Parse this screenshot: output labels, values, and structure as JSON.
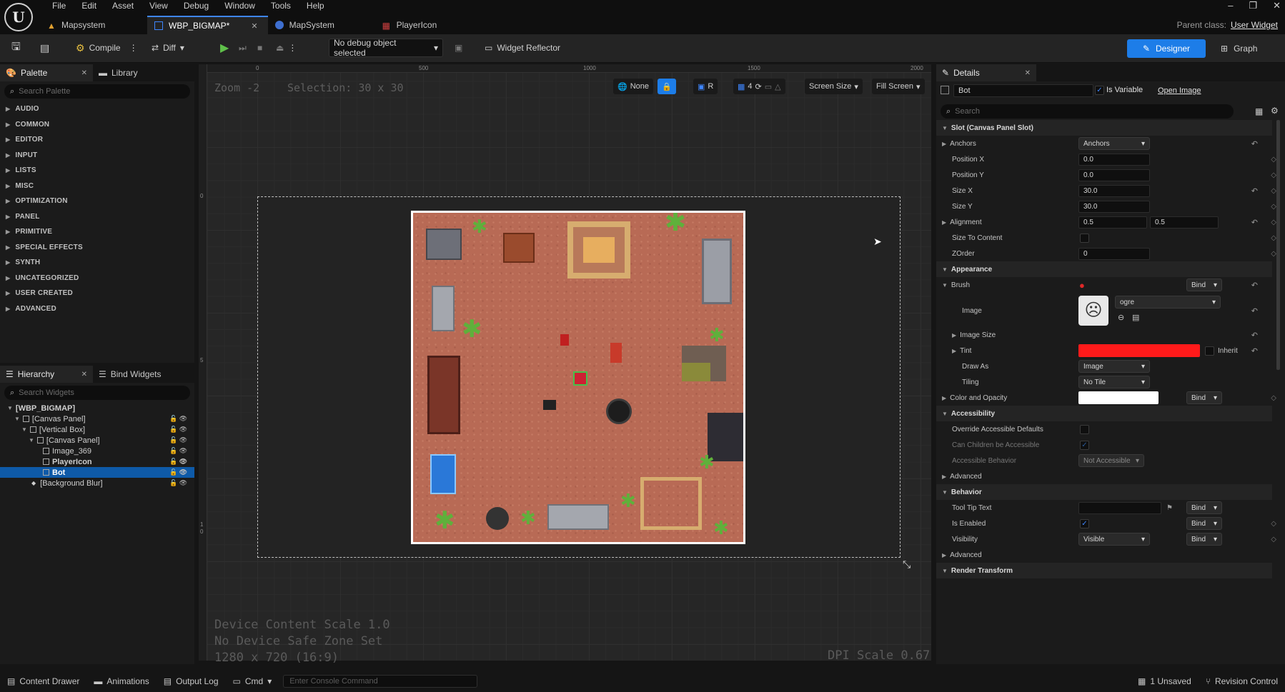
{
  "menu": [
    "File",
    "Edit",
    "Asset",
    "View",
    "Debug",
    "Window",
    "Tools",
    "Help"
  ],
  "tabs": [
    {
      "label": "Mapsystem"
    },
    {
      "label": "WBP_BIGMAP*"
    },
    {
      "label": "MapSystem"
    },
    {
      "label": "PlayerIcon"
    }
  ],
  "parent_class": {
    "label": "Parent class:",
    "value": "User Widget"
  },
  "toolbar": {
    "compile": "Compile",
    "diff": "Diff",
    "debug_object": "No debug object selected",
    "widget_reflector": "Widget Reflector",
    "designer": "Designer",
    "graph": "Graph"
  },
  "palette": {
    "tab": "Palette",
    "library_tab": "Library",
    "search_placeholder": "Search Palette",
    "categories": [
      "AUDIO",
      "COMMON",
      "EDITOR",
      "INPUT",
      "LISTS",
      "MISC",
      "OPTIMIZATION",
      "PANEL",
      "PRIMITIVE",
      "SPECIAL EFFECTS",
      "SYNTH",
      "UNCATEGORIZED",
      "USER CREATED",
      "ADVANCED"
    ]
  },
  "hierarchy": {
    "tab": "Hierarchy",
    "bind_tab": "Bind Widgets",
    "search_placeholder": "Search Widgets",
    "items": [
      "[WBP_BIGMAP]",
      "[Canvas Panel]",
      "[Vertical Box]",
      "[Canvas Panel]",
      "Image_369",
      "PlayerIcon",
      "Bot",
      "[Background Blur]"
    ]
  },
  "viewport": {
    "zoom": "Zoom -2",
    "selection": "Selection: 30 x 30",
    "device_scale": "Device Content Scale 1.0",
    "safe_zone": "No Device Safe Zone Set",
    "resolution": "1280 x 720 (16:9)",
    "dpi": "DPI Scale 0.67",
    "buttons": {
      "none": "None",
      "r": "R",
      "grid": "4",
      "screen_size": "Screen Size",
      "fill_screen": "Fill Screen"
    },
    "ruler_top": [
      "0",
      "500",
      "1000",
      "1500",
      "2000"
    ],
    "ruler_left": [
      "0",
      "5",
      "1",
      "0"
    ]
  },
  "details": {
    "tab": "Details",
    "name": "Bot",
    "is_variable": "Is Variable",
    "open_image": "Open Image",
    "search_placeholder": "Search",
    "slot_section": "Slot (Canvas Panel Slot)",
    "anchors": "Anchors",
    "anchors_value": "Anchors",
    "position_x": "Position X",
    "position_x_value": "0.0",
    "position_y": "Position Y",
    "position_y_value": "0.0",
    "size_x": "Size X",
    "size_x_value": "30.0",
    "size_y": "Size Y",
    "size_y_value": "30.0",
    "alignment": "Alignment",
    "alignment_x": "0.5",
    "alignment_y": "0.5",
    "size_to_content": "Size To Content",
    "zorder": "ZOrder",
    "zorder_value": "0",
    "appearance": "Appearance",
    "brush": "Brush",
    "bind": "Bind",
    "image": "Image",
    "image_value": "ogre",
    "image_size": "Image Size",
    "tint": "Tint",
    "inherit": "Inherit",
    "draw_as": "Draw As",
    "draw_as_value": "Image",
    "tiling": "Tiling",
    "tiling_value": "No Tile",
    "color_opacity": "Color and Opacity",
    "accessibility": "Accessibility",
    "override_defaults": "Override Accessible Defaults",
    "can_children": "Can Children be Accessible",
    "accessible_behavior": "Accessible Behavior",
    "accessible_behavior_value": "Not Accessible",
    "advanced": "Advanced",
    "behavior": "Behavior",
    "tooltip": "Tool Tip Text",
    "is_enabled": "Is Enabled",
    "visibility": "Visibility",
    "visibility_value": "Visible",
    "render_transform": "Render Transform",
    "tint_color": "#ff1a1a"
  },
  "statusbar": {
    "content_drawer": "Content Drawer",
    "animations": "Animations",
    "output_log": "Output Log",
    "cmd": "Cmd",
    "console_placeholder": "Enter Console Command",
    "unsaved": "1 Unsaved",
    "revision": "Revision Control"
  },
  "colors": {
    "accent": "#1d7de8",
    "map_ground": "#b86a55",
    "selection": "#0e5aa8"
  }
}
